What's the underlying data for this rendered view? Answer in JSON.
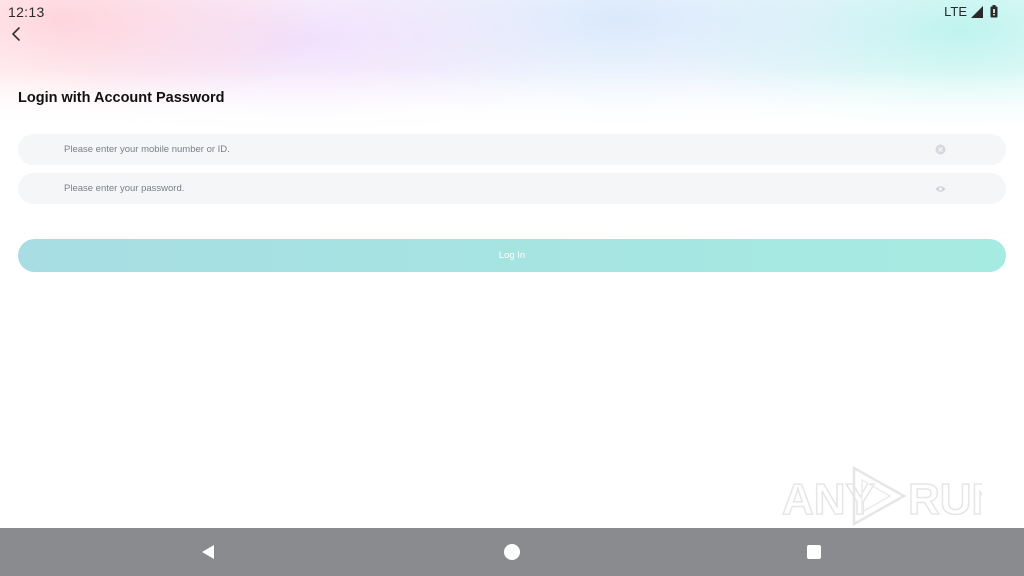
{
  "status_bar": {
    "time": "12:13",
    "network": "LTE",
    "icons": [
      "signal-icon",
      "battery-icon"
    ]
  },
  "header": {
    "back_icon": "chevron-left-icon",
    "title": "Login with Account Password"
  },
  "form": {
    "phone_field": {
      "placeholder": "Please enter your mobile number or ID.",
      "value": "",
      "trailing_icon": "clear-icon"
    },
    "password_field": {
      "placeholder": "Please enter your password.",
      "value": "",
      "trailing_icon": "eye-icon"
    },
    "login_label": "Log In"
  },
  "watermark": {
    "text_left": "ANY",
    "text_right": "RUN"
  },
  "nav_bar": {
    "buttons": [
      "back-triangle-icon",
      "home-circle-icon",
      "recents-square-icon"
    ]
  },
  "colors": {
    "login_button_start": "#a7dde3",
    "login_button_end": "#a6ebe2",
    "field_background": "#f4f6f8",
    "nav_bar": "#898b8e"
  }
}
